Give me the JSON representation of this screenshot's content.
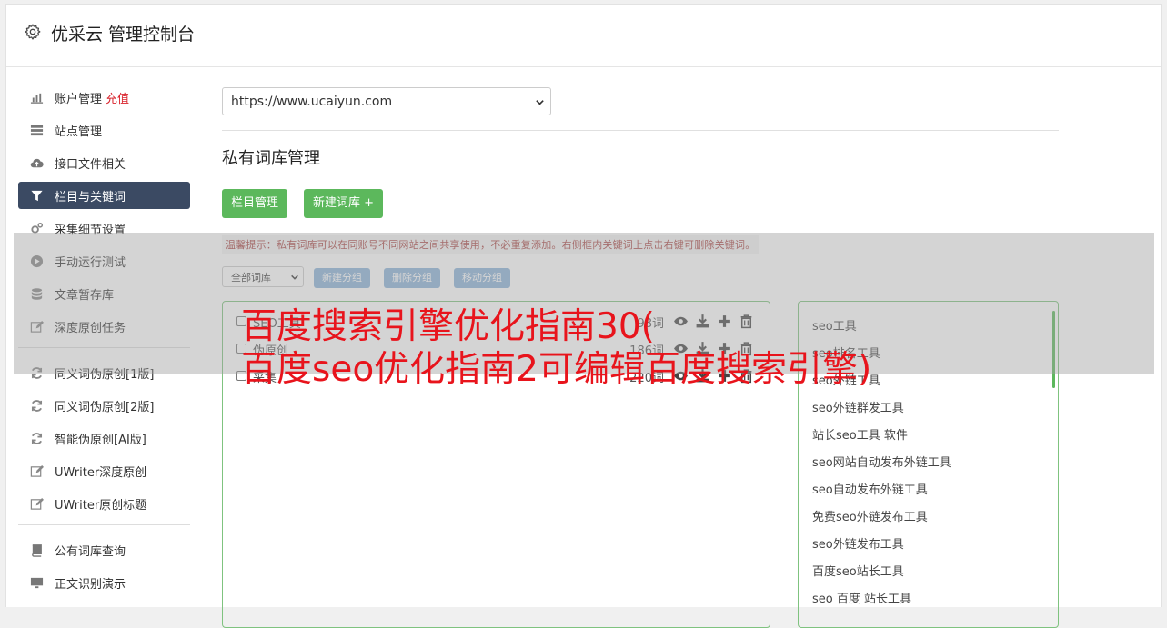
{
  "app": {
    "title": "优采云 管理控制台"
  },
  "sidebar": {
    "group1": [
      {
        "label": "账户管理",
        "badge": "充值",
        "icon": "bar-chart-icon"
      },
      {
        "label": "站点管理",
        "icon": "server-icon"
      },
      {
        "label": "接口文件相关",
        "icon": "cloud-upload-icon"
      },
      {
        "label": "栏目与关键词",
        "icon": "filter-icon",
        "active": true
      },
      {
        "label": "采集细节设置",
        "icon": "gears-icon"
      },
      {
        "label": "手动运行测试",
        "icon": "play-circle-icon"
      },
      {
        "label": "文章暂存库",
        "icon": "database-icon"
      },
      {
        "label": "深度原创任务",
        "icon": "edit-icon"
      }
    ],
    "group2": [
      {
        "label": "同义词伪原创[1版]",
        "icon": "refresh-icon"
      },
      {
        "label": "同义词伪原创[2版]",
        "icon": "refresh-icon"
      },
      {
        "label": "智能伪原创[AI版]",
        "icon": "refresh-icon"
      },
      {
        "label": "UWriter深度原创",
        "icon": "edit-icon"
      },
      {
        "label": "UWriter原创标题",
        "icon": "edit-icon"
      }
    ],
    "group3": [
      {
        "label": "公有词库查询",
        "icon": "book-icon"
      },
      {
        "label": "正文识别演示",
        "icon": "monitor-icon"
      }
    ]
  },
  "main": {
    "site_select": "https://www.ucaiyun.com",
    "section_title": "私有词库管理",
    "btn_columns": "栏目管理",
    "btn_new_lib": "新建词库 +",
    "tip": "温馨提示：私有词库可以在同账号不同网站之间共享使用，不必重复添加。右侧框内关键词上点击右键可删除关键词。",
    "filter_select": "全部词库",
    "btn_new_group": "新建分组",
    "btn_delete_group": "删除分组",
    "btn_move_group": "移动分组",
    "libraries": [
      {
        "name": "SEO工具",
        "count": "98词"
      },
      {
        "name": "伪原创",
        "count": "186词"
      },
      {
        "name": "采集",
        "count": "220词"
      }
    ],
    "keywords": [
      "seo工具",
      "seo排名工具",
      "seo外链工具",
      "seo外链群发工具",
      "站长seo工具 软件",
      "seo网站自动发布外链工具",
      "seo自动发布外链工具",
      "免费seo外链发布工具",
      "seo外链发布工具",
      "百度seo站长工具",
      "seo 百度 站长工具"
    ]
  },
  "overlay": {
    "line1": "百度搜索引擎优化指南30(",
    "line2": "百度seo优化指南2可编辑百度搜索引擎)"
  },
  "colors": {
    "green": "#5cb85c",
    "blue_btn": "#8bb2d9",
    "nav_active": "#3b4a63",
    "overlay_text": "#e8141c",
    "tip": "#a94442"
  }
}
